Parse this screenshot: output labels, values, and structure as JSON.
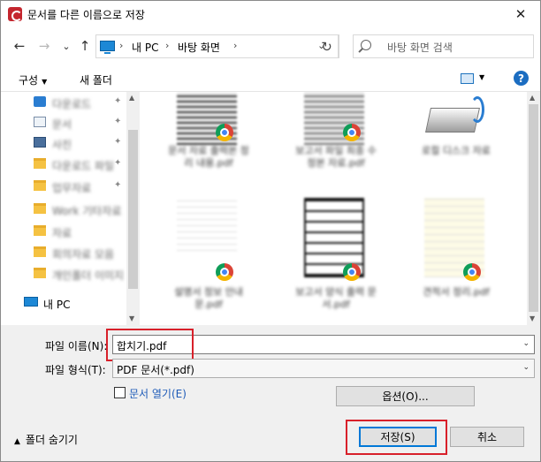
{
  "window": {
    "title": "문서를 다른 이름으로 저장",
    "close_glyph": "✕"
  },
  "nav": {
    "back_glyph": "←",
    "forward_glyph": "→",
    "dropdown_glyph": "⌄",
    "up_glyph": "↑",
    "breadcrumb": [
      "내 PC",
      "바탕 화면"
    ],
    "sep_glyph": "›",
    "refresh_glyph": "↻",
    "search_placeholder": "바탕 화면 검색"
  },
  "toolbar": {
    "organize": "구성",
    "new_folder": "새 폴더",
    "help": "?"
  },
  "sidebar": {
    "items": [
      {
        "label": "다운로드",
        "icon": "download-icon"
      },
      {
        "label": "문서",
        "icon": "document-icon"
      },
      {
        "label": "사진",
        "icon": "picture-icon"
      },
      {
        "label": "다운로드 파일",
        "icon": "folder-icon"
      },
      {
        "label": "업무자료",
        "icon": "folder-icon"
      },
      {
        "label": "Work 기타자료",
        "icon": "folder-icon"
      },
      {
        "label": "자료",
        "icon": "folder-icon"
      },
      {
        "label": "회의자료 모음",
        "icon": "folder-icon"
      },
      {
        "label": "개인폴더 이미지",
        "icon": "folder-icon"
      }
    ],
    "pc_label": "내 PC"
  },
  "files": [
    {
      "name": "문서 자료 출력본 정리 내용.pdf"
    },
    {
      "name": "보고서 파일 최종 수정본 자료.pdf"
    },
    {
      "name": "로컬 디스크 자료"
    },
    {
      "name": "설명서 정보 안내문.pdf"
    },
    {
      "name": "보고서 양식 출력 문서.pdf"
    },
    {
      "name": "견적서 정리.pdf"
    }
  ],
  "form": {
    "filename_label": "파일 이름(N):",
    "filename_value": "합치기.pdf",
    "filetype_label": "파일 형식(T):",
    "filetype_value": "PDF 문서(*.pdf)",
    "open_doc_label": "문서 열기(E)",
    "options_label": "옵션(O)...",
    "hide_folders_label": "폴더 숨기기",
    "save_label": "저장(S)",
    "cancel_label": "취소"
  },
  "colors": {
    "accent": "#0078d7",
    "highlight": "#d8202a",
    "link": "#1e5bb8"
  }
}
